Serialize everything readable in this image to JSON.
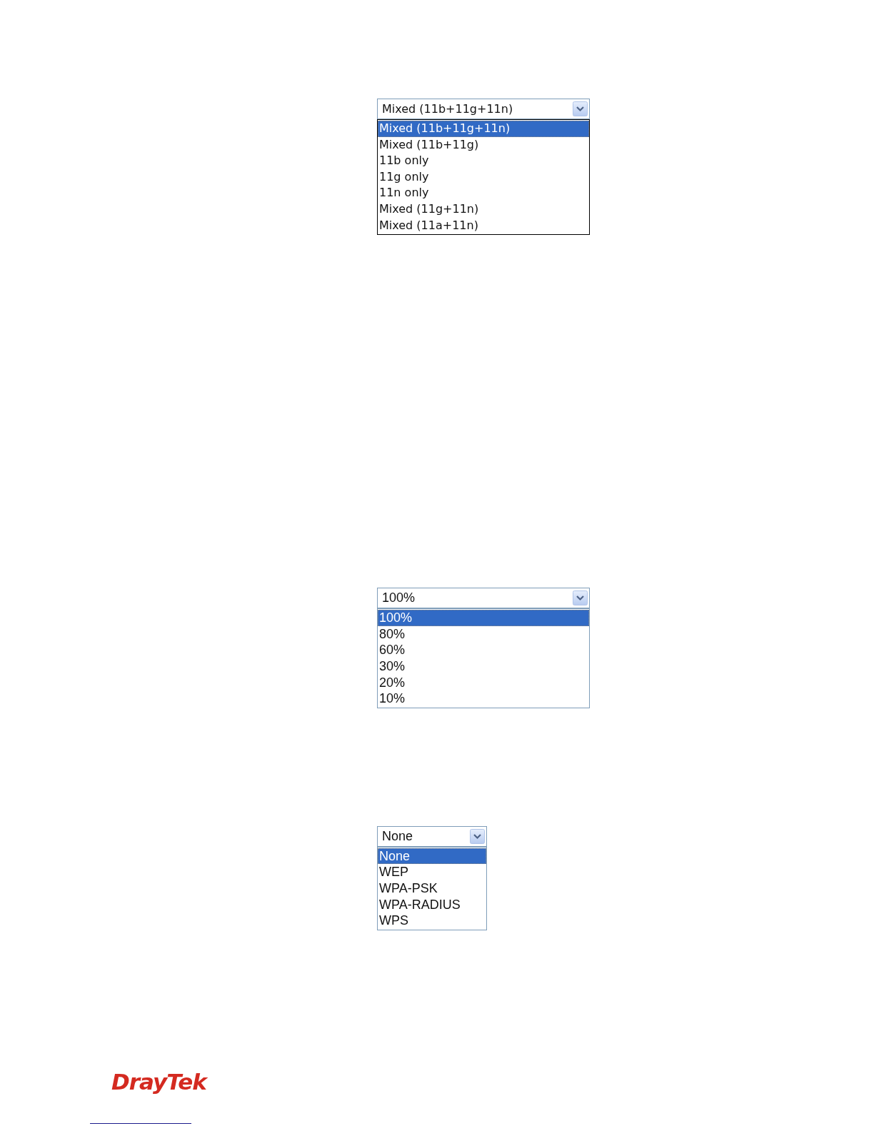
{
  "dropdowns": [
    {
      "value": "Mixed (11b+11g+11n)",
      "options": [
        {
          "label": "Mixed (11b+11g+11n)",
          "selected": true
        },
        {
          "label": "Mixed (11b+11g)",
          "selected": false
        },
        {
          "label": "11b only",
          "selected": false
        },
        {
          "label": "11g only",
          "selected": false
        },
        {
          "label": "11n only",
          "selected": false
        },
        {
          "label": "Mixed (11g+11n)",
          "selected": false
        },
        {
          "label": "Mixed (11a+11n)",
          "selected": false
        }
      ]
    },
    {
      "value": "100%",
      "options": [
        {
          "label": "100%",
          "selected": true
        },
        {
          "label": "80%",
          "selected": false
        },
        {
          "label": "60%",
          "selected": false
        },
        {
          "label": "30%",
          "selected": false
        },
        {
          "label": "20%",
          "selected": false
        },
        {
          "label": "10%",
          "selected": false
        }
      ]
    },
    {
      "value": "None",
      "options": [
        {
          "label": "None",
          "selected": true
        },
        {
          "label": "WEP",
          "selected": false
        },
        {
          "label": "WPA-PSK",
          "selected": false
        },
        {
          "label": "WPA-RADIUS",
          "selected": false
        },
        {
          "label": "WPS",
          "selected": false
        }
      ]
    }
  ],
  "footer": {
    "logo": "DrayTek"
  }
}
